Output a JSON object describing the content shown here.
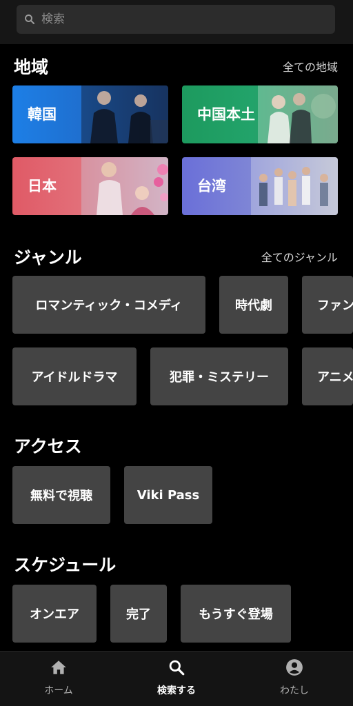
{
  "search": {
    "placeholder": "検索"
  },
  "regions": {
    "title": "地域",
    "link": "全ての地域",
    "items": [
      {
        "label": "韓国",
        "color": "#1d7fe6"
      },
      {
        "label": "中国本土",
        "color": "#1d9a5e"
      },
      {
        "label": "日本",
        "color": "#e05a66"
      },
      {
        "label": "台湾",
        "color": "#6a6fd8"
      }
    ]
  },
  "genres": {
    "title": "ジャンル",
    "link": "全てのジャンル",
    "row1": [
      "ロマンティック・コメディ",
      "時代劇",
      "ファン"
    ],
    "row2": [
      "アイドルドラマ",
      "犯罪・ミステリー",
      "アニメ"
    ]
  },
  "access": {
    "title": "アクセス",
    "items": [
      "無料で視聴",
      "Viki Pass"
    ]
  },
  "schedule": {
    "title": "スケジュール",
    "items": [
      "オンエア",
      "完了",
      "もうすぐ登場"
    ]
  },
  "nav": {
    "home": "ホーム",
    "search": "検索する",
    "me": "わたし"
  }
}
